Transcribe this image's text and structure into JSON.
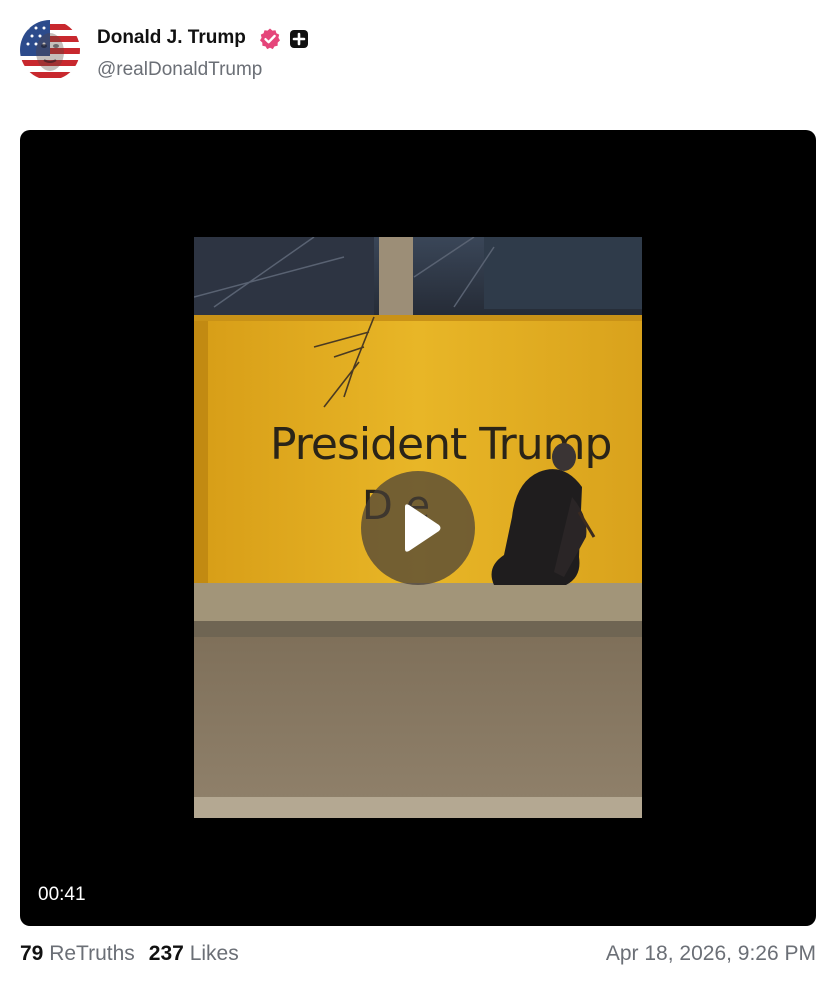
{
  "author": {
    "display_name": "Donald J. Trump",
    "handle": "@realDonaldTrump",
    "verified_icon": "verified-badge-icon",
    "extra_icon": "plus-square-icon"
  },
  "media": {
    "type": "video",
    "duration": "00:41",
    "play_icon": "play-icon",
    "wall_text": "President Trump"
  },
  "stats": {
    "retruths_count": "79",
    "retruths_label": "ReTruths",
    "likes_count": "237",
    "likes_label": "Likes"
  },
  "timestamp": "Apr 18, 2026, 9:26 PM",
  "colors": {
    "verified_pink": "#e5457a",
    "muted_text": "#6b6f76",
    "video_bg": "#000000",
    "wall_yellow": "#e7b321"
  }
}
